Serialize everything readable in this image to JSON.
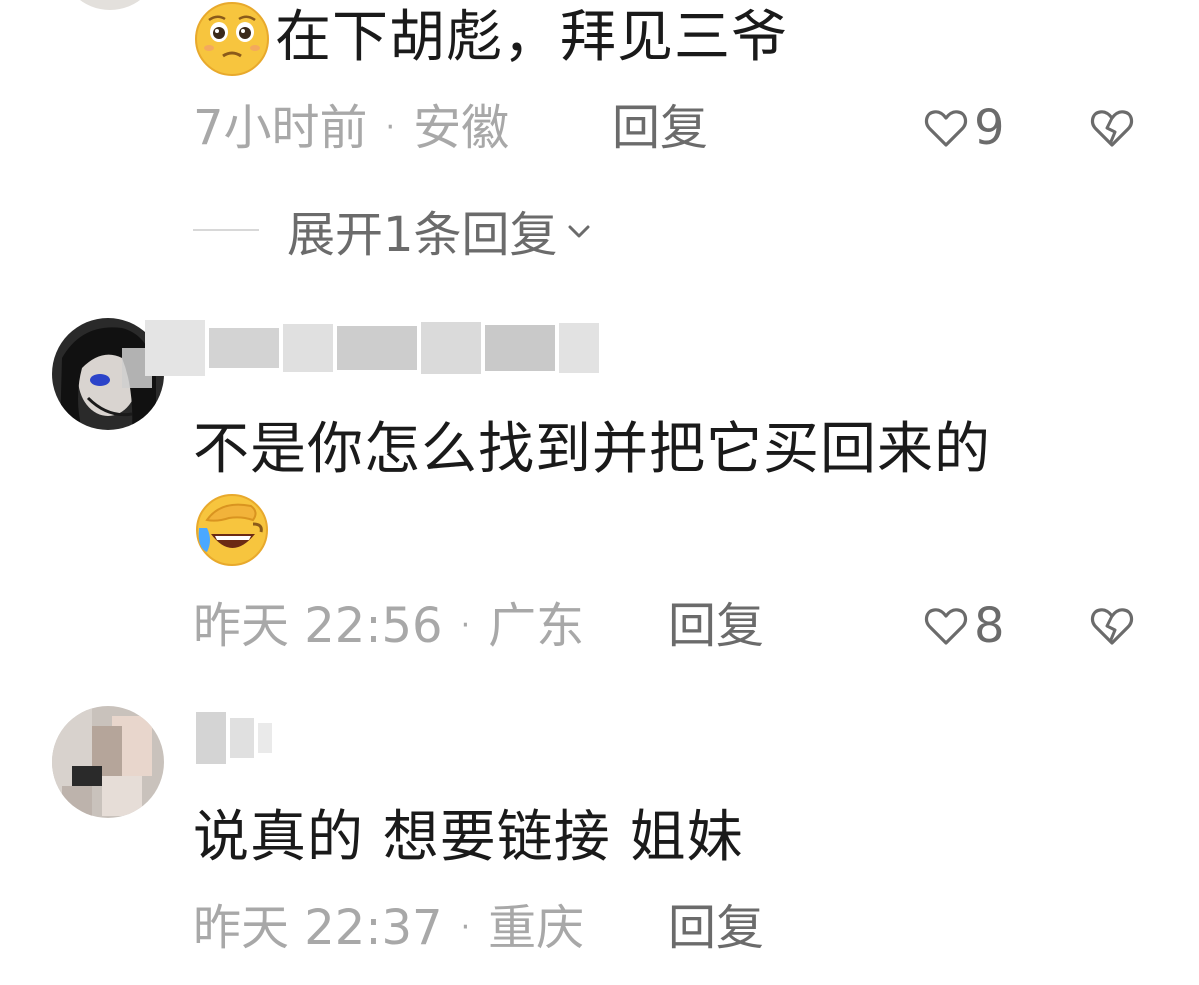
{
  "comments": [
    {
      "text": "在下胡彪，拜见三爷",
      "time": "7小时前",
      "location": "安徽",
      "reply_label": "回复",
      "likes": "9",
      "emoji": "pleading-face-emoji"
    },
    {
      "text": "不是你怎么找到并把它买回来的",
      "time": "昨天 22:56",
      "location": "广东",
      "reply_label": "回复",
      "likes": "8",
      "emoji": "facepalm-laugh-emoji"
    },
    {
      "text": "说真的 想要链接 姐妹",
      "time": "昨天 22:37",
      "location": "重庆",
      "reply_label": "回复"
    }
  ],
  "expand_replies": {
    "label": "展开1条回复"
  },
  "colors": {
    "text_primary": "#1a1a1a",
    "text_meta": "#a8a8a8",
    "text_action": "#6b6b6b",
    "emoji_yellow": "#f7c53e"
  },
  "icons": {
    "like": "heart-outline-icon",
    "dislike": "broken-heart-icon",
    "expand": "chevron-down-icon"
  }
}
